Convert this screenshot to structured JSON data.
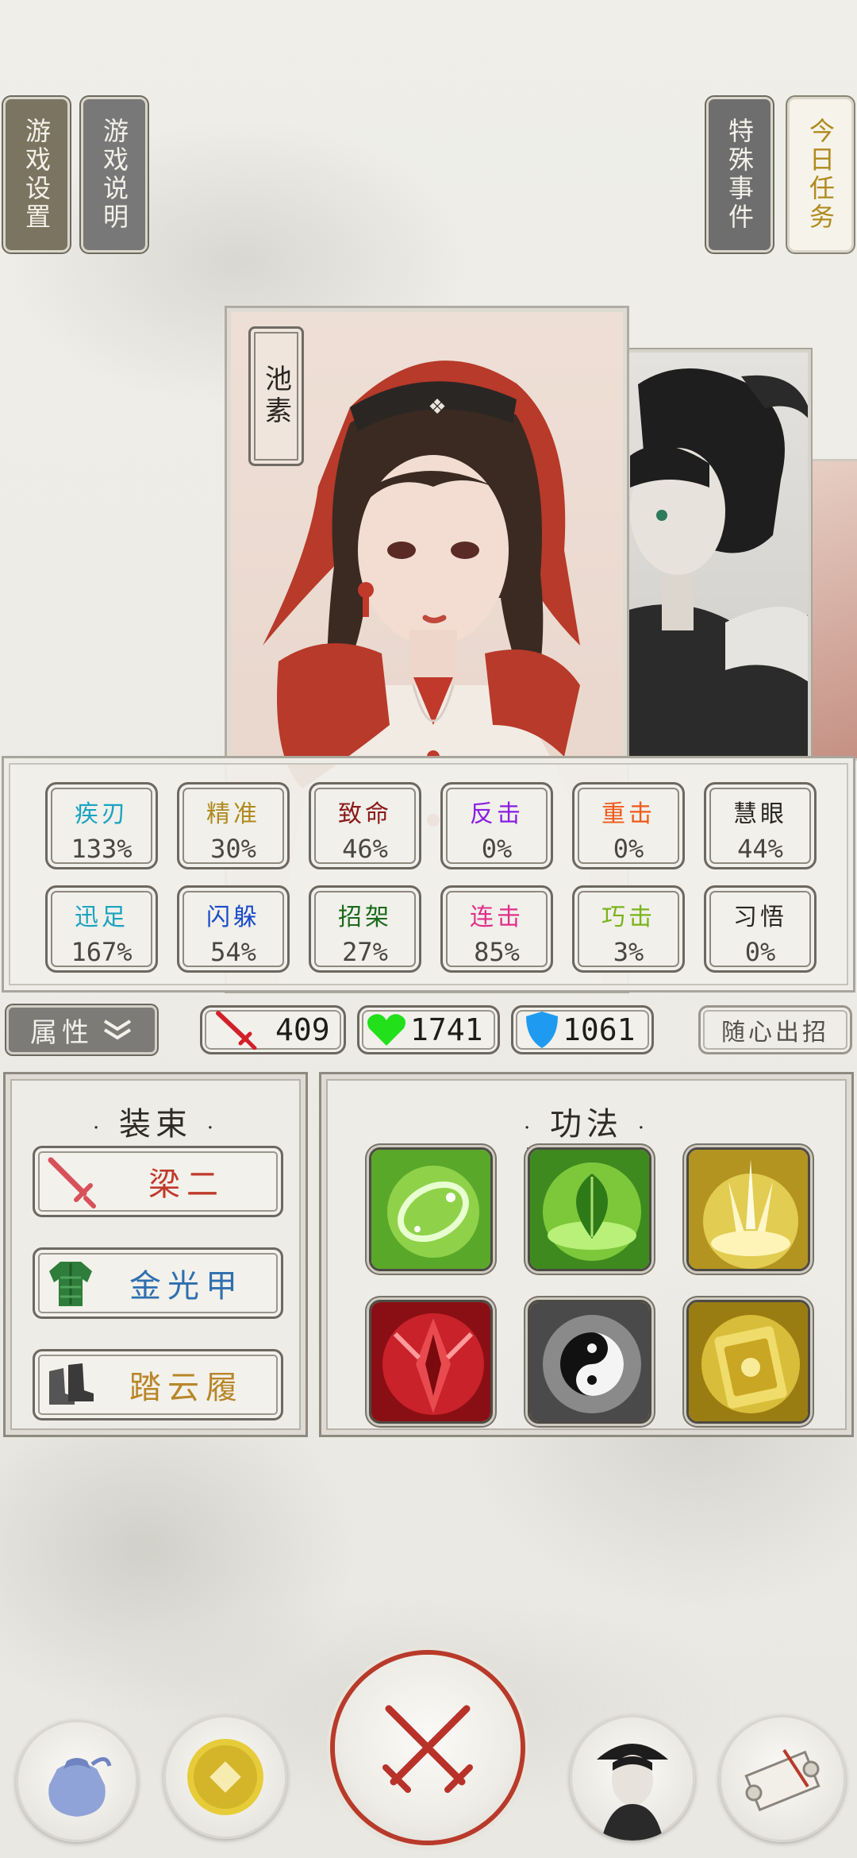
{
  "top_buttons": {
    "settings": "游戏设置",
    "help": "游戏说明",
    "events": "特殊事件",
    "daily": "今日任务"
  },
  "character": {
    "name": "池素"
  },
  "stats": [
    {
      "label": "疾刃",
      "value": "133%",
      "color": "#1aa3c0"
    },
    {
      "label": "精准",
      "value": "30%",
      "color": "#b08a1e"
    },
    {
      "label": "致命",
      "value": "46%",
      "color": "#8b1a1a"
    },
    {
      "label": "反击",
      "value": "0%",
      "color": "#8a1ee0"
    },
    {
      "label": "重击",
      "value": "0%",
      "color": "#f05a1a"
    },
    {
      "label": "慧眼",
      "value": "44%",
      "color": "#2a2622"
    },
    {
      "label": "迅足",
      "value": "167%",
      "color": "#1aa3c0"
    },
    {
      "label": "闪躲",
      "value": "54%",
      "color": "#1a4ac8"
    },
    {
      "label": "招架",
      "value": "27%",
      "color": "#1a6a1a"
    },
    {
      "label": "连击",
      "value": "85%",
      "color": "#e0308a"
    },
    {
      "label": "巧击",
      "value": "3%",
      "color": "#7ab41a"
    },
    {
      "label": "习悟",
      "value": "0%",
      "color": "#2a2622"
    }
  ],
  "attr_bar": {
    "label": "属性",
    "attack": "409",
    "hp": "1741",
    "defense": "1061",
    "auto_label": "随心出招"
  },
  "equipment": {
    "title": "装束",
    "items": [
      {
        "name": "梁二",
        "color": "#c0392b",
        "icon": "sword-icon"
      },
      {
        "name": "金光甲",
        "color": "#2f6fb0",
        "icon": "armor-icon"
      },
      {
        "name": "踏云履",
        "color": "#b8862a",
        "icon": "boots-icon"
      }
    ]
  },
  "skills": {
    "title": "功法",
    "items": [
      {
        "icon": "green-swirl-skill-icon"
      },
      {
        "icon": "leaf-skill-icon"
      },
      {
        "icon": "gold-sword-burst-skill-icon"
      },
      {
        "icon": "red-blade-skill-icon"
      },
      {
        "icon": "yin-yang-skill-icon"
      },
      {
        "icon": "gold-scroll-skill-icon"
      }
    ]
  },
  "bottom_nav": [
    {
      "icon": "bag-icon"
    },
    {
      "icon": "coin-icon"
    },
    {
      "icon": "crossed-swords-icon"
    },
    {
      "icon": "character-portrait-icon"
    },
    {
      "icon": "scroll-icon"
    }
  ]
}
